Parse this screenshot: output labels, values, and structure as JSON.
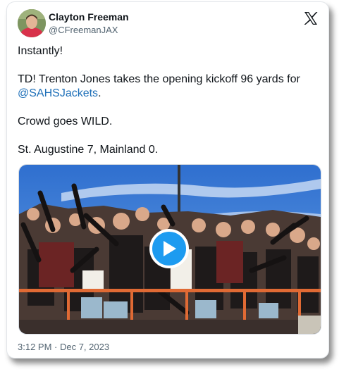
{
  "author": {
    "name": "Clayton Freeman",
    "handle": "@CFreemanJAX"
  },
  "tweet": {
    "line1": "Instantly!",
    "line2_text": "TD! Trenton Jones takes the opening kickoff 96 yards for ",
    "line2_mention": "@SAHSJackets",
    "line2_end": ".",
    "line3": "Crowd goes WILD.",
    "line4": "St. Augustine 7, Mainland 0."
  },
  "timestamp": "3:12 PM · Dec 7, 2023",
  "icons": {
    "platform": "x-logo-icon",
    "play": "play-icon"
  },
  "colors": {
    "mention": "#1d6fb8",
    "play_button": "#1d9bf0"
  }
}
